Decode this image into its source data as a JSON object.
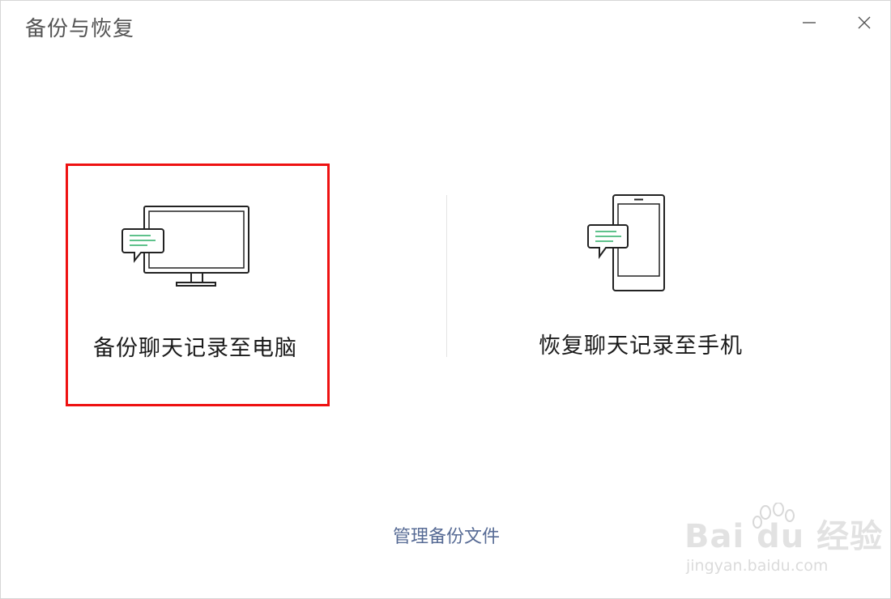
{
  "window": {
    "title": "备份与恢复"
  },
  "options": {
    "backup_to_pc": {
      "label": "备份聊天记录至电脑",
      "icon": "monitor-chat-icon"
    },
    "restore_to_phone": {
      "label": "恢复聊天记录至手机",
      "icon": "phone-chat-icon"
    }
  },
  "footer": {
    "manage_link": "管理备份文件"
  },
  "watermark": {
    "brand": "Bai du 经验",
    "url": "jingyan.baidu.com"
  },
  "colors": {
    "selection_border": "#ee1111",
    "link": "#576b95",
    "chat_lines": "#2aae67"
  }
}
